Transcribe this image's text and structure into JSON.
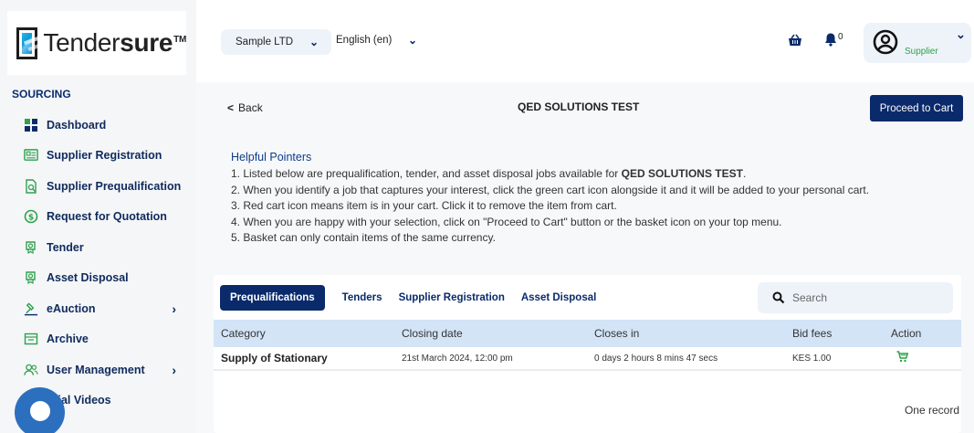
{
  "brand": {
    "name_light": "Tender",
    "name_bold": "sure",
    "tm": "TM"
  },
  "sidebar": {
    "section_label": "SOURCING",
    "items": [
      {
        "label": "Dashboard",
        "icon": "dashboard-icon"
      },
      {
        "label": "Supplier Registration",
        "icon": "registration-icon"
      },
      {
        "label": "Supplier Prequalification",
        "icon": "prequalification-icon"
      },
      {
        "label": "Request for Quotation",
        "icon": "quotation-icon"
      },
      {
        "label": "Tender",
        "icon": "tender-icon"
      },
      {
        "label": "Asset Disposal",
        "icon": "asset-disposal-icon"
      },
      {
        "label": "eAuction",
        "icon": "gavel-icon",
        "chevron": true
      },
      {
        "label": "Archive",
        "icon": "archive-icon"
      },
      {
        "label": "User Management",
        "icon": "users-icon",
        "chevron": true
      },
      {
        "label": "orial Videos",
        "icon": "video-icon"
      }
    ]
  },
  "topbar": {
    "company": "Sample LTD",
    "language": "English (en)",
    "notification_count": "0",
    "user_role": "Supplier"
  },
  "main": {
    "back_label": "Back",
    "title": "QED SOLUTIONS TEST",
    "proceed_button": "Proceed to Cart",
    "pointers": {
      "heading": "Helpful Pointers",
      "line1_prefix": "1. Listed below are prequalification, tender, and asset disposal jobs available for ",
      "line1_bold": "QED SOLUTIONS TEST",
      "line1_suffix": ".",
      "line2": "2. When you identify a job that captures your interest, click the green cart icon alongside it and it will be added to your personal cart.",
      "line3": "3. Red cart icon means item is in your cart. Click it to remove the item from cart.",
      "line4": "4. When you are happy with your selection, click on \"Proceed to Cart\" button or the basket icon on your top menu.",
      "line5": "5. Basket can only contain items of the same currency."
    },
    "tabs": [
      "Prequalifications",
      "Tenders",
      "Supplier Registration",
      "Asset Disposal"
    ],
    "search_placeholder": "Search",
    "table": {
      "headers": [
        "Category",
        "Closing date",
        "Closes in",
        "Bid fees",
        "Action"
      ],
      "rows": [
        {
          "category": "Supply of Stationary",
          "closing": "21st March 2024, 12:00 pm",
          "closes_in": "0 days 2 hours 8 mins 47 secs",
          "fees": "KES 1.00"
        }
      ]
    },
    "records_text": "One record"
  },
  "colors": {
    "navy": "#0a2a6b",
    "header_row": "#d3e4f7",
    "cart_green": "#2ea24c",
    "accent_blue": "#0c3d8b"
  }
}
